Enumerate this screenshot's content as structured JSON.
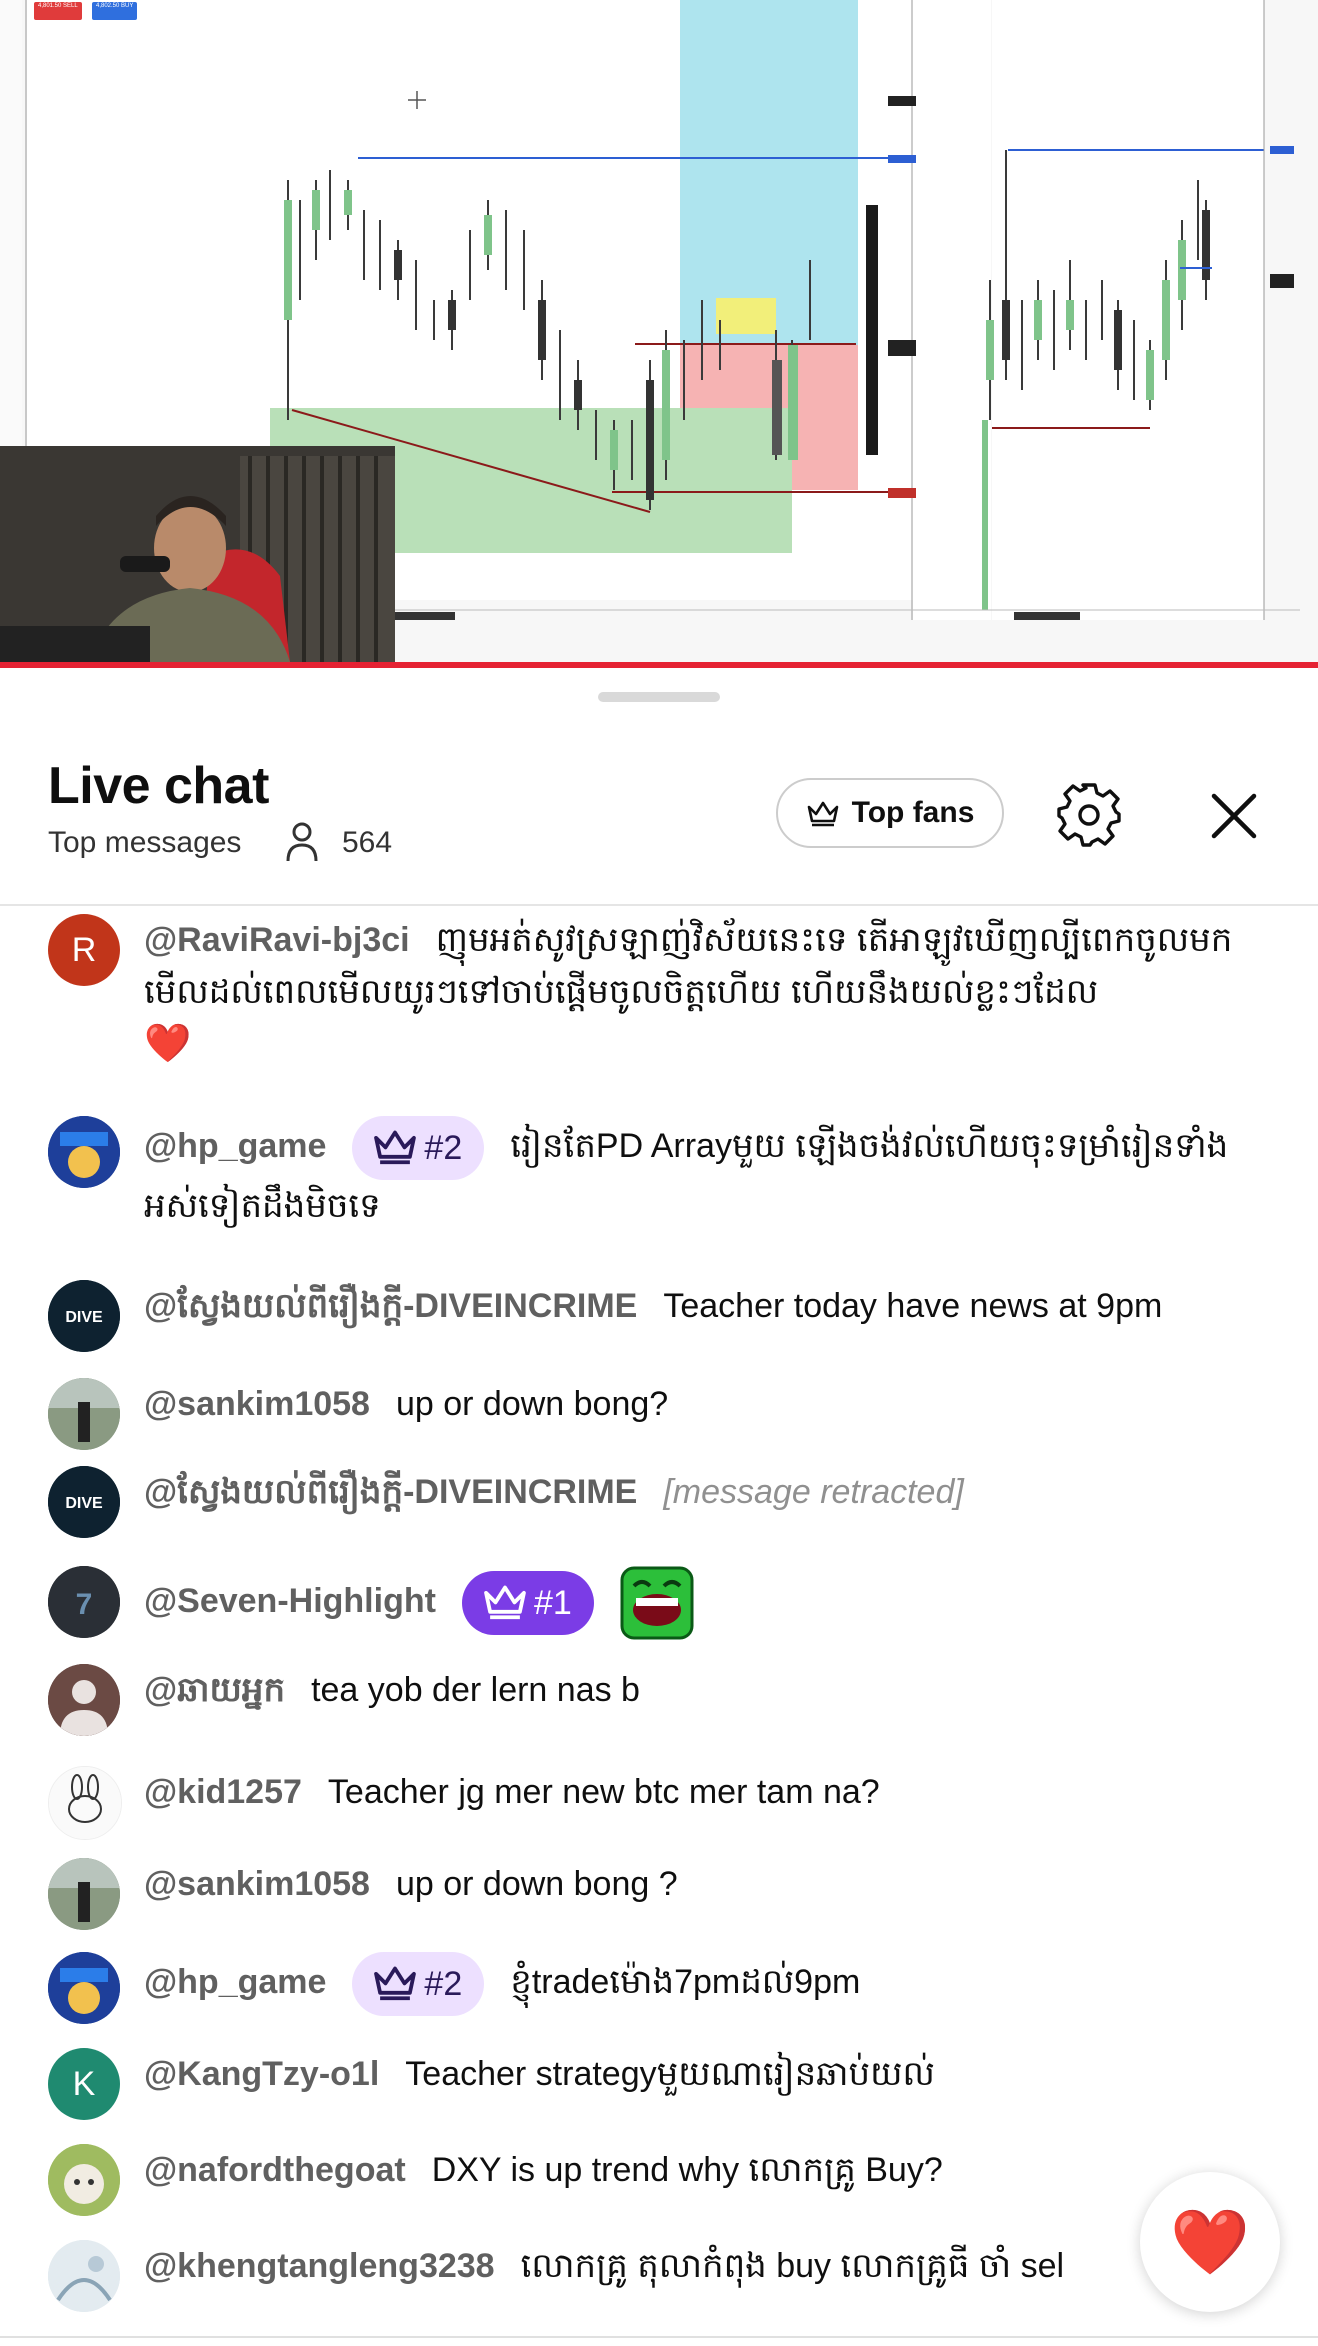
{
  "video": {
    "sell_chip": "4,801.50 SELL",
    "buy_chip": "4,802.50 BUY"
  },
  "chat": {
    "title": "Live chat",
    "mode": "Top messages",
    "viewer_count": "564",
    "top_fans_label": "Top fans"
  },
  "messages": [
    {
      "author": "@RaviRavi-bj3ci",
      "avatar": "R",
      "avatar_color": "#c1351a",
      "text": "ញុមអត់សូវស្រឡាញ់វិស័យនេះទេ តើអាឡូវឃើញល្បីពេកចូលមកមើលដល់ពេលមើលយូរៗទៅចាប់ផ្តើមចូលចិត្តហើយ ហើយនឹងយល់ខ្លះៗដែល",
      "emoji": "❤️"
    },
    {
      "author": "@hp_game",
      "badge": "#2",
      "text": "រៀនតែPD Arrayមួយ ឡើងចង់វល់ហើយចុះទម្រាំរៀនទាំងអស់ទៀតដឹងមិចទេ"
    },
    {
      "author": "@ស្វែងយល់ពីរឿងក្តី-DIVEINCRIME",
      "text": "Teacher today have news at 9pm"
    },
    {
      "author": "@sankim1058",
      "text": "up or down bong?"
    },
    {
      "author": "@ស្វែងយល់ពីរឿងក្តី-DIVEINCRIME",
      "text": "[message retracted]"
    },
    {
      "author": "@Seven-Highlight",
      "badge": "#1",
      "text": ""
    },
    {
      "author": "@ឆាយអ្នក",
      "text": "tea yob der lern nas b"
    },
    {
      "author": "@kid1257",
      "text": "Teacher jg mer new btc mer tam na?"
    },
    {
      "author": "@sankim1058",
      "text": "up or down bong ?"
    },
    {
      "author": "@hp_game",
      "badge": "#2",
      "text": "ខ្ញុំtradeម៉ោង7pmដល់9pm"
    },
    {
      "author": "@KangTzy-o1l",
      "avatar": "K",
      "avatar_color": "#1f8a70",
      "text": "Teacher strategyមួយណារៀនឆាប់យល់"
    },
    {
      "author": "@nafordthegoat",
      "text": "DXY is up trend why លោកគ្រូ Buy?"
    },
    {
      "author": "@khengtangleng3238",
      "text": "លោកគ្រូ តុលាកំពុង buy លោកគ្រូធី ចាំ sel"
    }
  ],
  "heart_fab": "❤️"
}
